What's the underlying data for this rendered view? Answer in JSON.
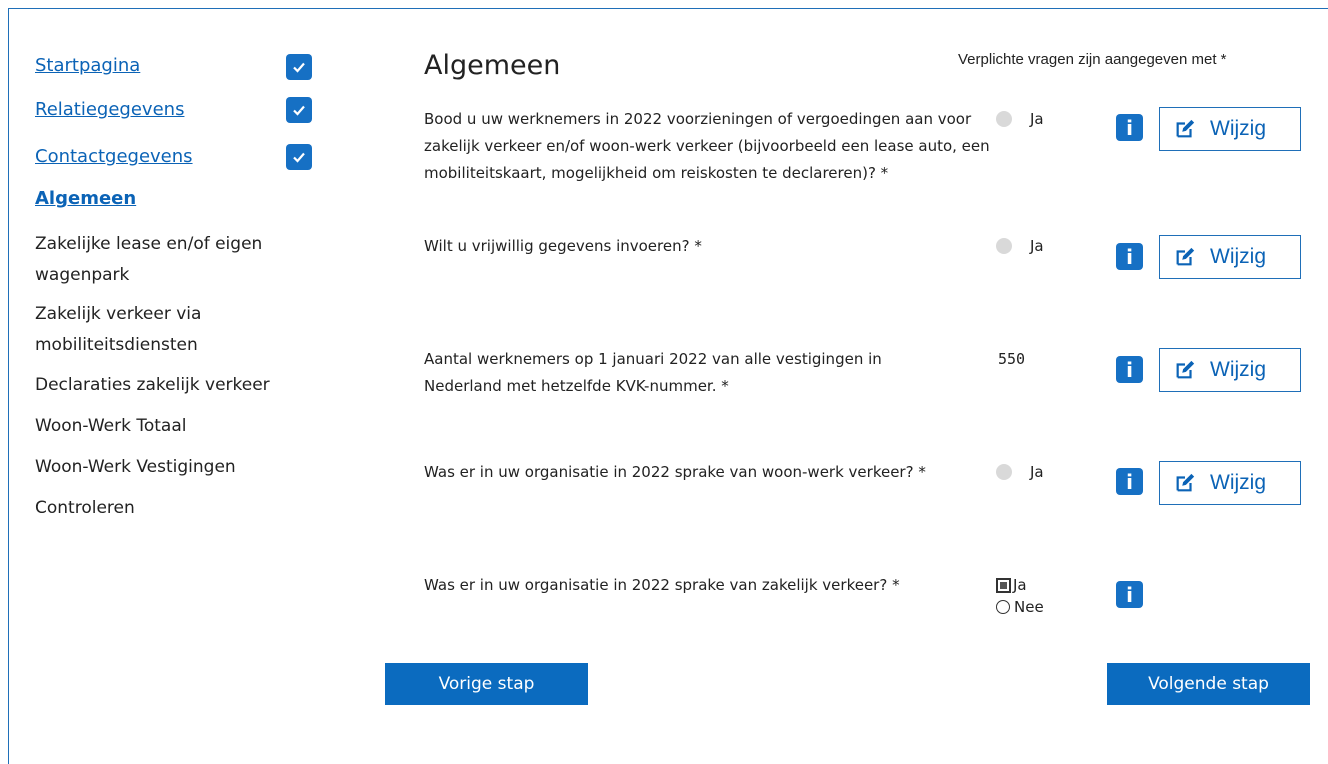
{
  "sidebar": {
    "items": [
      {
        "label": "Startpagina",
        "completed": true
      },
      {
        "label": "Relatiegegevens",
        "completed": true
      },
      {
        "label": "Contactgegevens",
        "completed": true
      },
      {
        "label": "Algemeen",
        "active": true
      },
      {
        "label": "Zakelijke lease en/of eigen wagenpark"
      },
      {
        "label": "Zakelijk verkeer via mobiliteitsdiensten"
      },
      {
        "label": "Declaraties zakelijk verkeer"
      },
      {
        "label": "Woon-Werk Totaal"
      },
      {
        "label": "Woon-Werk Vestigingen"
      },
      {
        "label": "Controleren"
      }
    ]
  },
  "main": {
    "title": "Algemeen",
    "required_note": "Verplichte vragen zijn aangegeven met *",
    "questions": [
      {
        "text": "Bood u uw werknemers in 2022 voorzieningen of vergoedingen aan voor zakelijk verkeer en/of woon-werk verkeer (bijvoorbeeld een lease auto, een mobiliteitskaart, mogelijkheid om reiskosten te declareren)? *",
        "answer": "Ja",
        "edit_label": "Wijzig"
      },
      {
        "text": "Wilt u vrijwillig gegevens invoeren? *",
        "answer": "Ja",
        "edit_label": "Wijzig"
      },
      {
        "text": "Aantal werknemers op 1 januari 2022 van alle vestigingen in Nederland met hetzelfde KVK-nummer. *",
        "answer": "550",
        "edit_label": "Wijzig"
      },
      {
        "text": "Was er in uw organisatie in 2022 sprake van woon-werk verkeer? *",
        "answer": "Ja",
        "edit_label": "Wijzig"
      },
      {
        "text": "Was er in uw organisatie in 2022 sprake van zakelijk verkeer? *",
        "options": [
          "Ja",
          "Nee"
        ],
        "selected": "Ja"
      }
    ],
    "info_label": "i"
  },
  "footer": {
    "prev_label": "Vorige stap",
    "next_label": "Volgende stap"
  },
  "colors": {
    "accent": "#0b6bbf",
    "link": "#0b63b6"
  }
}
